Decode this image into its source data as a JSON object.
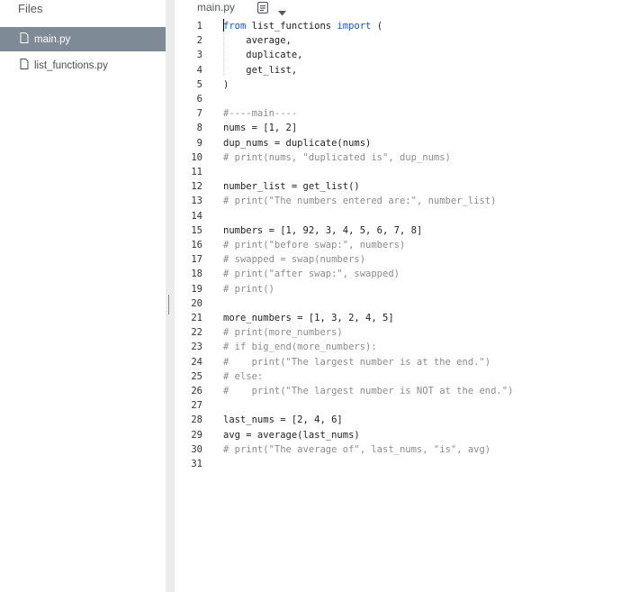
{
  "sidebar": {
    "title": "Files",
    "files": [
      {
        "name": "main.py",
        "active": true
      },
      {
        "name": "list_functions.py",
        "active": false
      }
    ]
  },
  "tab": {
    "name": "main.py"
  },
  "editor": {
    "lines": [
      {
        "n": "1",
        "text": "from list_functions import ("
      },
      {
        "n": "2",
        "text": "    average,"
      },
      {
        "n": "3",
        "text": "    duplicate,"
      },
      {
        "n": "4",
        "text": "    get_list,"
      },
      {
        "n": "5",
        "text": ")"
      },
      {
        "n": "6",
        "text": ""
      },
      {
        "n": "7",
        "text": "#----main----"
      },
      {
        "n": "8",
        "text": "nums = [1, 2]"
      },
      {
        "n": "9",
        "text": "dup_nums = duplicate(nums)"
      },
      {
        "n": "10",
        "text": "# print(nums, \"duplicated is\", dup_nums)"
      },
      {
        "n": "11",
        "text": ""
      },
      {
        "n": "12",
        "text": "number_list = get_list()"
      },
      {
        "n": "13",
        "text": "# print(\"The numbers entered are:\", number_list)"
      },
      {
        "n": "14",
        "text": ""
      },
      {
        "n": "15",
        "text": "numbers = [1, 92, 3, 4, 5, 6, 7, 8]"
      },
      {
        "n": "16",
        "text": "# print(\"before swap:\", numbers)"
      },
      {
        "n": "17",
        "text": "# swapped = swap(numbers)"
      },
      {
        "n": "18",
        "text": "# print(\"after swap:\", swapped)"
      },
      {
        "n": "19",
        "text": "# print()"
      },
      {
        "n": "20",
        "text": ""
      },
      {
        "n": "21",
        "text": "more_numbers = [1, 3, 2, 4, 5]"
      },
      {
        "n": "22",
        "text": "# print(more_numbers)"
      },
      {
        "n": "23",
        "text": "# if big_end(more_numbers):"
      },
      {
        "n": "24",
        "text": "#    print(\"The largest number is at the end.\")"
      },
      {
        "n": "25",
        "text": "# else:"
      },
      {
        "n": "26",
        "text": "#    print(\"The largest number is NOT at the end.\")"
      },
      {
        "n": "27",
        "text": ""
      },
      {
        "n": "28",
        "text": "last_nums = [2, 4, 6]"
      },
      {
        "n": "29",
        "text": "avg = average(last_nums)"
      },
      {
        "n": "30",
        "text": "# print(\"The average of\", last_nums, \"is\", avg)"
      },
      {
        "n": "31",
        "text": ""
      }
    ]
  },
  "icons": {
    "file": "file-icon",
    "document": "document-icon",
    "dropdown": "chevron-down-icon"
  },
  "colors": {
    "active_file_bg": "#7e8a96",
    "keyword": "#1d4fd6",
    "comment": "#8c8c8c"
  }
}
